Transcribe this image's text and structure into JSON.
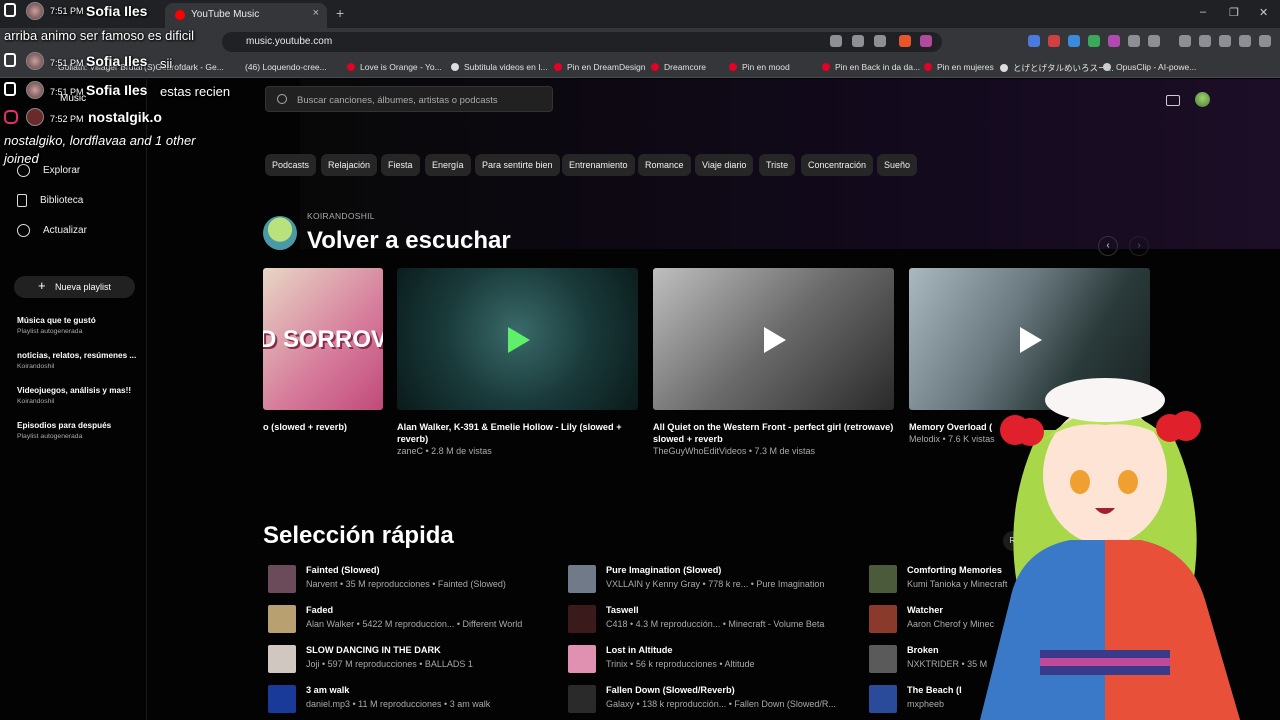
{
  "browser": {
    "tab_title": "YouTube Music",
    "tab_close": "×",
    "new_tab": "+",
    "url": "music.youtube.com",
    "window_min": "–",
    "window_max": "❐",
    "window_close": "✕"
  },
  "bookmarks": [
    "Goliath: Villager Brutal",
    "(S)Gearofdark - Ge...",
    "(46) Loquendo-cree...",
    "Love is Orange - Yo...",
    "Subtitula videos en I...",
    "Pin en DreamDesign",
    "Dreamcore",
    "Pin en mood",
    "Pin en Back in da da...",
    "Pin en mujeres",
    "とげとげタルめいろスー...",
    "OpusClip - AI-powe..."
  ],
  "app": {
    "logo": "Music",
    "search_placeholder": "Buscar canciones, álbumes, artistas o podcasts"
  },
  "sidebar": {
    "nav": [
      "Explorar",
      "Biblioteca",
      "Actualizar"
    ],
    "new_playlist": "Nueva playlist",
    "new_playlist_icon": "+",
    "playlists": [
      {
        "title": "Música que te gustó",
        "sub": "Playlist autogenerada"
      },
      {
        "title": "noticias, relatos, resúmenes ...",
        "sub": "Koirandoshil"
      },
      {
        "title": "Videojuegos, análisis y mas!!",
        "sub": "Koirandoshil"
      },
      {
        "title": "Episodios para después",
        "sub": "Playlist autogenerada"
      }
    ]
  },
  "chips": [
    "Podcasts",
    "Relajación",
    "Fiesta",
    "Energía",
    "Para sentirte bien",
    "Entrenamiento",
    "Romance",
    "Viaje diario",
    "Triste",
    "Concentración",
    "Sueño"
  ],
  "listen_again": {
    "subtitle": "KOIRANDOSHIL",
    "title": "Volver a escuchar",
    "prev": "‹",
    "next": "›",
    "cards": [
      {
        "title": "o (slowed + reverb)",
        "meta": "",
        "art_text": "D SORROV"
      },
      {
        "title": "Alan Walker, K-391 & Emelie Hollow - Lily (slowed + reverb)",
        "meta": "zaneC • 2.8 M de vistas"
      },
      {
        "title": "All Quiet on the Western Front - perfect girl (retrowave) slowed + reverb",
        "meta": "TheGuyWhoEditVideos • 7.3 M de vistas"
      },
      {
        "title": "Memory Overload (",
        "meta": "Melodix • 7.6 K vistas"
      }
    ]
  },
  "quick_picks": {
    "title": "Selección rápida",
    "play_all": "Reprodu...",
    "songs": [
      {
        "title": "Fainted (Slowed)",
        "meta": "Narvent • 35 M reproducciones • Fainted (Slowed)",
        "color": "#6b4a5a"
      },
      {
        "title": "Faded",
        "meta": "Alan Walker • 5422 M reproduccion... • Different World",
        "color": "#b8a070"
      },
      {
        "title": "SLOW DANCING IN THE DARK",
        "meta": "Joji • 597 M reproducciones • BALLADS 1",
        "color": "#d0c8c0"
      },
      {
        "title": "3 am walk",
        "meta": "daniel.mp3 • 11 M reproducciones • 3 am walk",
        "color": "#1a3a9a"
      },
      {
        "title": "Pure Imagination (Slowed)",
        "meta": "VXLLAIN y Kenny Gray • 778 k re... • Pure Imagination",
        "color": "#707a88"
      },
      {
        "title": "Taswell",
        "meta": "C418 • 4.3 M reproducción... • Minecraft - Volume Beta",
        "color": "#3a1a1a"
      },
      {
        "title": "Lost in Altitude",
        "meta": "Trinix • 56 k reproducciones • Altitude",
        "color": "#e090b0"
      },
      {
        "title": "Fallen Down (Slowed/Reverb)",
        "meta": "Galaxy • 138 k reproducción... • Fallen Down (Slowed/R...",
        "color": "#2a2a2a"
      },
      {
        "title": "Comforting Memories",
        "meta": "Kumi Tanioka y Minecraft",
        "color": "#4a5a3a"
      },
      {
        "title": "Watcher",
        "meta": "Aaron Cherof y Minec",
        "color": "#8a3a2a"
      },
      {
        "title": "Broken",
        "meta": "NXKTRIDER • 35 M",
        "color": "#5a5a5a"
      },
      {
        "title": "The Beach (I",
        "meta": "mxpheeb",
        "color": "#2a4a9a"
      }
    ]
  },
  "overlay": {
    "lines": [
      {
        "time": "7:51 PM",
        "name": "Sofia Iles",
        "msg": ""
      },
      {
        "time": "",
        "name": "",
        "msg": "arriba animo ser famoso es dificil"
      },
      {
        "time": "7:51 PM",
        "name": "Sofia Iles",
        "msg": "sii"
      },
      {
        "time": "7:51 PM",
        "name": "Sofia Iles",
        "msg": "estas recien"
      },
      {
        "time": "7:52 PM",
        "name": "nostalgik.o",
        "msg": ""
      },
      {
        "time": "",
        "name": "",
        "msg": "nostalgiko, lordflavaa and 1 other"
      },
      {
        "time": "",
        "name": "",
        "msg": "joined"
      }
    ]
  }
}
